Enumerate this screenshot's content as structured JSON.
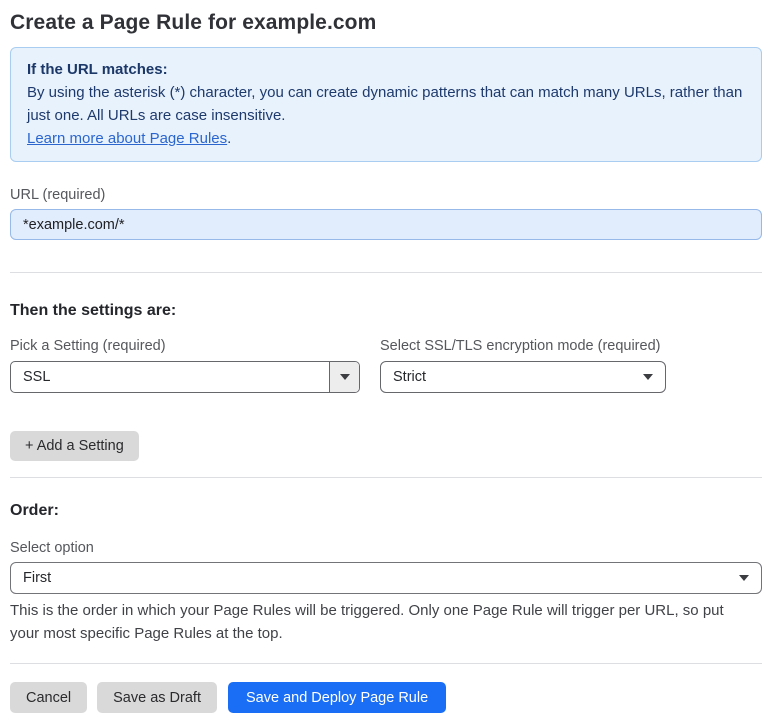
{
  "page": {
    "title": "Create a Page Rule for example.com"
  },
  "info_box": {
    "heading": "If the URL matches:",
    "body": "By using the asterisk (*) character, you can create dynamic patterns that can match many URLs, rather than just one. All URLs are case insensitive.",
    "link_label": "Learn more about Page Rules",
    "link_suffix": "."
  },
  "url_field": {
    "label": "URL (required)",
    "value": "*example.com/*"
  },
  "settings_section": {
    "heading": "Then the settings are:",
    "setting_picker": {
      "label": "Pick a Setting (required)",
      "value": "SSL"
    },
    "mode_picker": {
      "label": "Select SSL/TLS encryption mode (required)",
      "value": "Strict"
    },
    "add_setting_label": "+ Add a Setting"
  },
  "order_section": {
    "heading": "Order:",
    "select_label": "Select option",
    "value": "First",
    "help_text": "This is the order in which your Page Rules will be triggered. Only one Page Rule will trigger per URL, so put your most specific Page Rules at the top."
  },
  "footer": {
    "cancel_label": "Cancel",
    "save_draft_label": "Save as Draft",
    "save_deploy_label": "Save and Deploy Page Rule"
  },
  "colors": {
    "accent_blue": "#1a6ef5",
    "info_bg": "#e8f2fc",
    "info_border": "#a9cdf0",
    "info_text": "#1e3a6d",
    "link_blue": "#2b66cf",
    "input_bg": "#e1ecfc",
    "input_border": "#96b9e9",
    "button_gray": "#d9d9d9"
  }
}
